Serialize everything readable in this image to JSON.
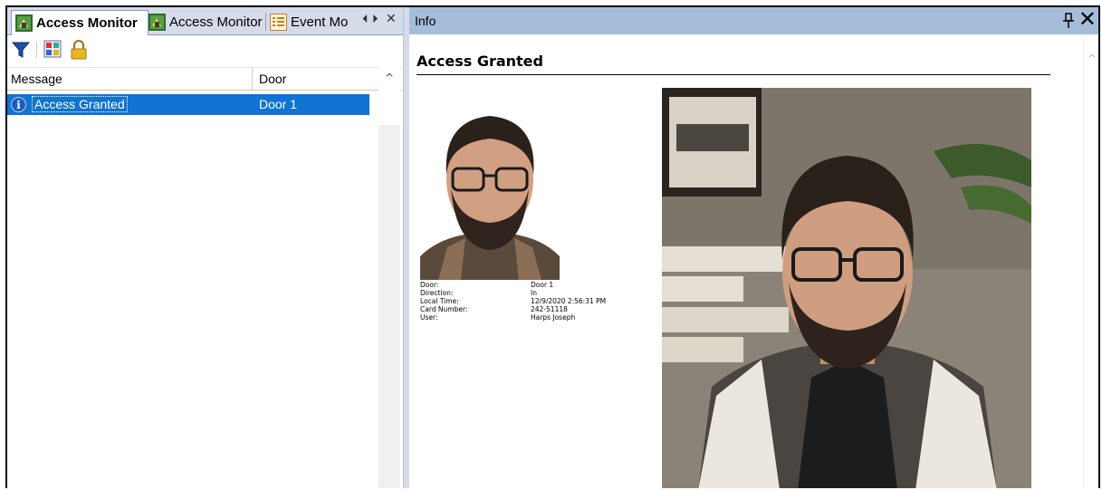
{
  "left_pane": {
    "tabs": [
      {
        "label": "Access Monitor",
        "icon": "access-monitor-icon",
        "active": true
      },
      {
        "label": "Access Monitor",
        "icon": "access-monitor-icon",
        "active": false
      },
      {
        "label": "Event Mo",
        "icon": "event-monitor-icon",
        "active": false
      }
    ],
    "nav": {
      "prev": "⏴",
      "next": "⏵",
      "close": "✕"
    },
    "toolbar": {
      "items": [
        "filter-icon",
        "image-icon",
        "lock-icon"
      ]
    },
    "grid": {
      "columns": [
        "Message",
        "Door"
      ],
      "rows": [
        {
          "icon": "info-icon",
          "message": "Access Granted",
          "door": "Door 1",
          "selected": true
        }
      ]
    }
  },
  "info_pane": {
    "title": "Info",
    "pin": "ꟷ",
    "close": "✕",
    "heading": "Access Granted",
    "details": [
      {
        "label": "Door:",
        "value": "Door 1"
      },
      {
        "label": "Direction:",
        "value": "In"
      },
      {
        "label": "Local Time:",
        "value": "12/9/2020 2:56:31 PM"
      },
      {
        "label": "Card Number:",
        "value": "242-51118"
      },
      {
        "label": "User:",
        "value": "Harps Joseph"
      }
    ]
  },
  "colors": {
    "selection": "#1173d3",
    "tabbar": "#d6dbe9",
    "info_header": "#a6bdda"
  }
}
